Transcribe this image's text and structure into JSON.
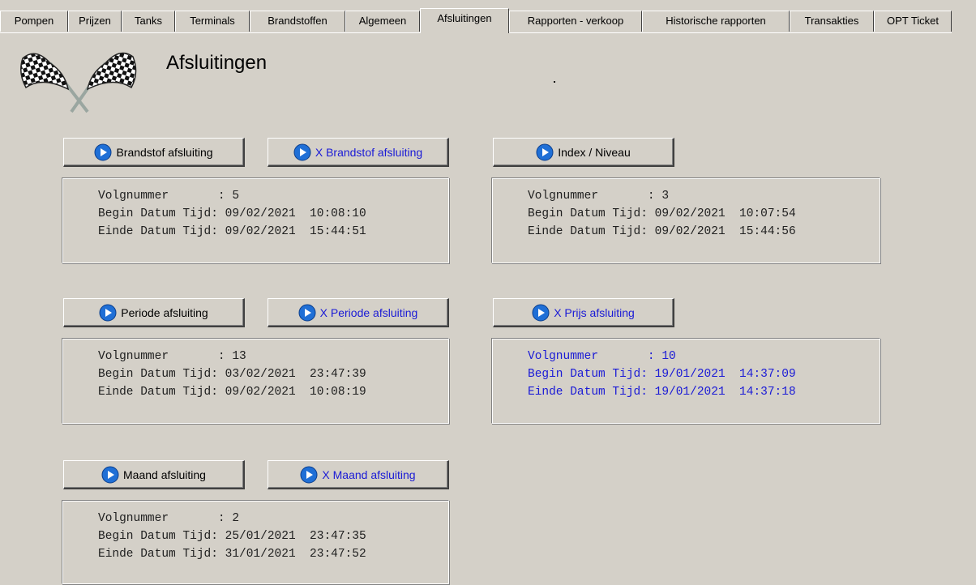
{
  "tabs": [
    {
      "label": "Pompen"
    },
    {
      "label": "Prijzen"
    },
    {
      "label": "Tanks"
    },
    {
      "label": "Terminals"
    },
    {
      "label": "Brandstoffen"
    },
    {
      "label": "Algemeen"
    },
    {
      "label": "Afsluitingen",
      "active": true
    },
    {
      "label": "Rapporten - verkoop"
    },
    {
      "label": "Historische rapporten"
    },
    {
      "label": "Transakties"
    },
    {
      "label": "OPT Ticket"
    }
  ],
  "header": {
    "title": "Afsluitingen",
    "logo_icon": "checkered-flags-icon"
  },
  "buttons": {
    "brandstof": "Brandstof afsluiting",
    "x_brandstof": "X Brandstof afsluiting",
    "index": "Index / Niveau",
    "periode": "Periode afsluiting",
    "x_periode": "X Periode afsluiting",
    "x_prijs": "X Prijs afsluiting",
    "maand": "Maand afsluiting",
    "x_maand": "X Maand afsluiting"
  },
  "panels": {
    "brandstof": [
      "Volgnummer       : 5",
      "Begin Datum Tijd: 09/02/2021  10:08:10",
      "Einde Datum Tijd: 09/02/2021  15:44:51"
    ],
    "index": [
      "Volgnummer       : 3",
      "Begin Datum Tijd: 09/02/2021  10:07:54",
      "Einde Datum Tijd: 09/02/2021  15:44:56"
    ],
    "periode": [
      "Volgnummer       : 13",
      "Begin Datum Tijd: 03/02/2021  23:47:39",
      "Einde Datum Tijd: 09/02/2021  10:08:19"
    ],
    "prijs": [
      "Volgnummer       : 10",
      "Begin Datum Tijd: 19/01/2021  14:37:09",
      "Einde Datum Tijd: 19/01/2021  14:37:18"
    ],
    "maand": [
      "Volgnummer       : 2",
      "Begin Datum Tijd: 25/01/2021  23:47:35",
      "Einde Datum Tijd: 31/01/2021  23:47:52"
    ]
  },
  "colors": {
    "background": "#d4d0c8",
    "x_text": "#1a1ad6",
    "play_icon": "#1f6fd6"
  },
  "icons": {
    "button_icon": "play-circle-icon"
  }
}
